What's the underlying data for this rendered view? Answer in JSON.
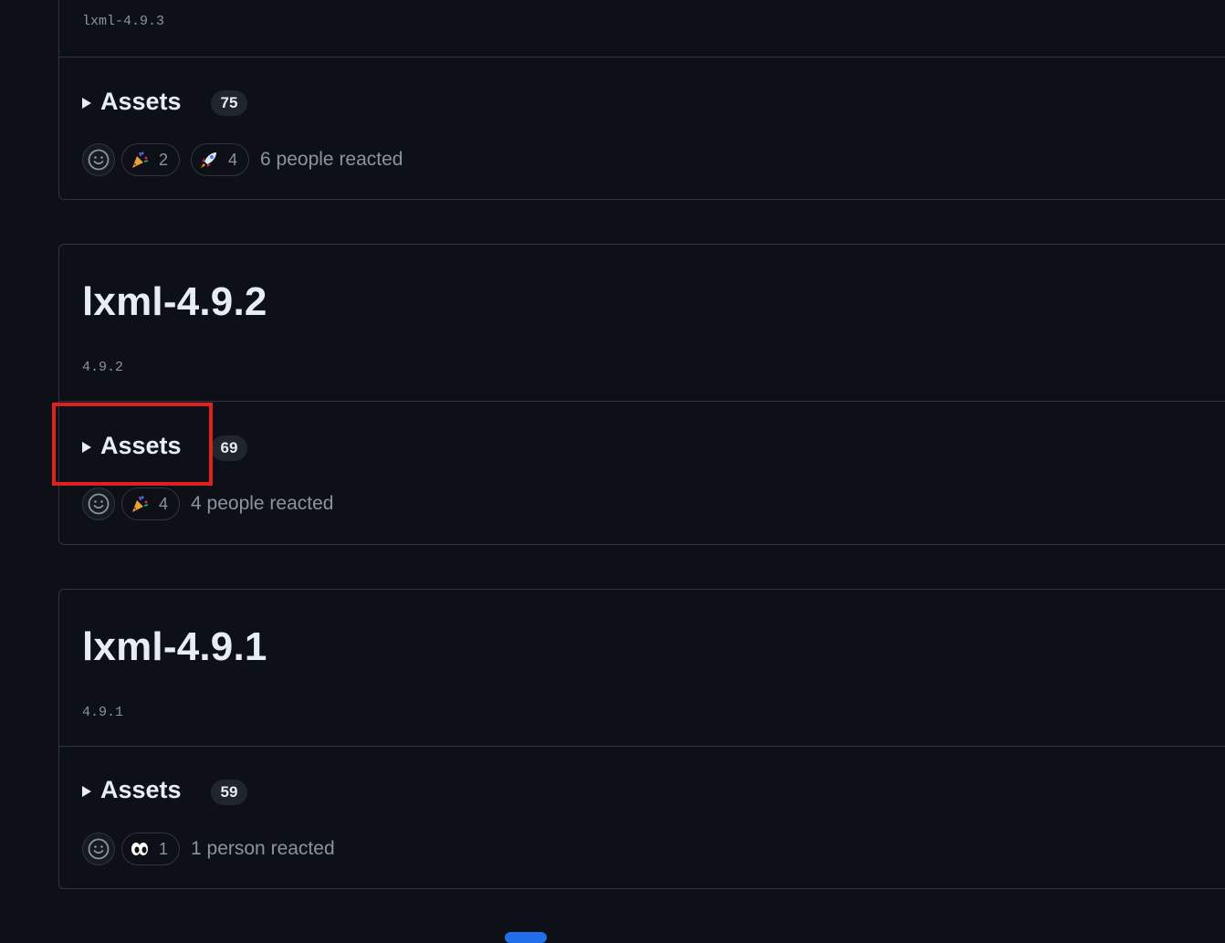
{
  "releases": [
    {
      "tag": "lxml-4.9.3",
      "assets_label": "Assets",
      "assets_count": "75",
      "reactions": [
        {
          "emoji": "tada-icon",
          "count": "2"
        },
        {
          "emoji": "rocket-icon",
          "count": "4"
        }
      ],
      "reacted_text": "6 people reacted"
    },
    {
      "title": "lxml-4.9.2",
      "tag": "4.9.2",
      "assets_label": "Assets",
      "assets_count": "69",
      "reactions": [
        {
          "emoji": "tada-icon",
          "count": "4"
        }
      ],
      "reacted_text": "4 people reacted"
    },
    {
      "title": "lxml-4.9.1",
      "tag": "4.9.1",
      "assets_label": "Assets",
      "assets_count": "59",
      "reactions": [
        {
          "emoji": "eyes-icon",
          "count": "1"
        }
      ],
      "reacted_text": "1 person reacted"
    }
  ],
  "colors": {
    "background": "#0d1117",
    "border": "#30363d",
    "highlight": "#e0201f",
    "accent": "#1f6feb"
  }
}
